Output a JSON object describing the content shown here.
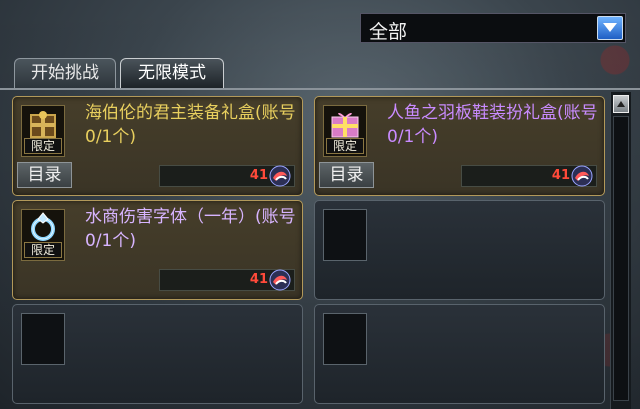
{
  "filter": {
    "selected": "全部"
  },
  "tabs": [
    {
      "label": "开始挑战",
      "active": false
    },
    {
      "label": "无限模式",
      "active": true
    }
  ],
  "items": [
    {
      "name": "海伯伦的君主装备礼盒(账号 0/1个)",
      "badge": "限定",
      "catalog": "目录",
      "price": "41",
      "icon": "golden-gift-box-icon",
      "title_color": "#e8cf5e"
    },
    {
      "name": "人鱼之羽板鞋装扮礼盒(账号 0/1个)",
      "badge": "限定",
      "catalog": "目录",
      "price": "41",
      "icon": "pink-gift-box-icon",
      "title_color": "#c98bff"
    },
    {
      "name": "水商伤害字体（一年）(账号 0/1个)",
      "badge": "限定",
      "price": "41",
      "icon": "ring-icon",
      "title_color": "#d7b4ff"
    }
  ]
}
